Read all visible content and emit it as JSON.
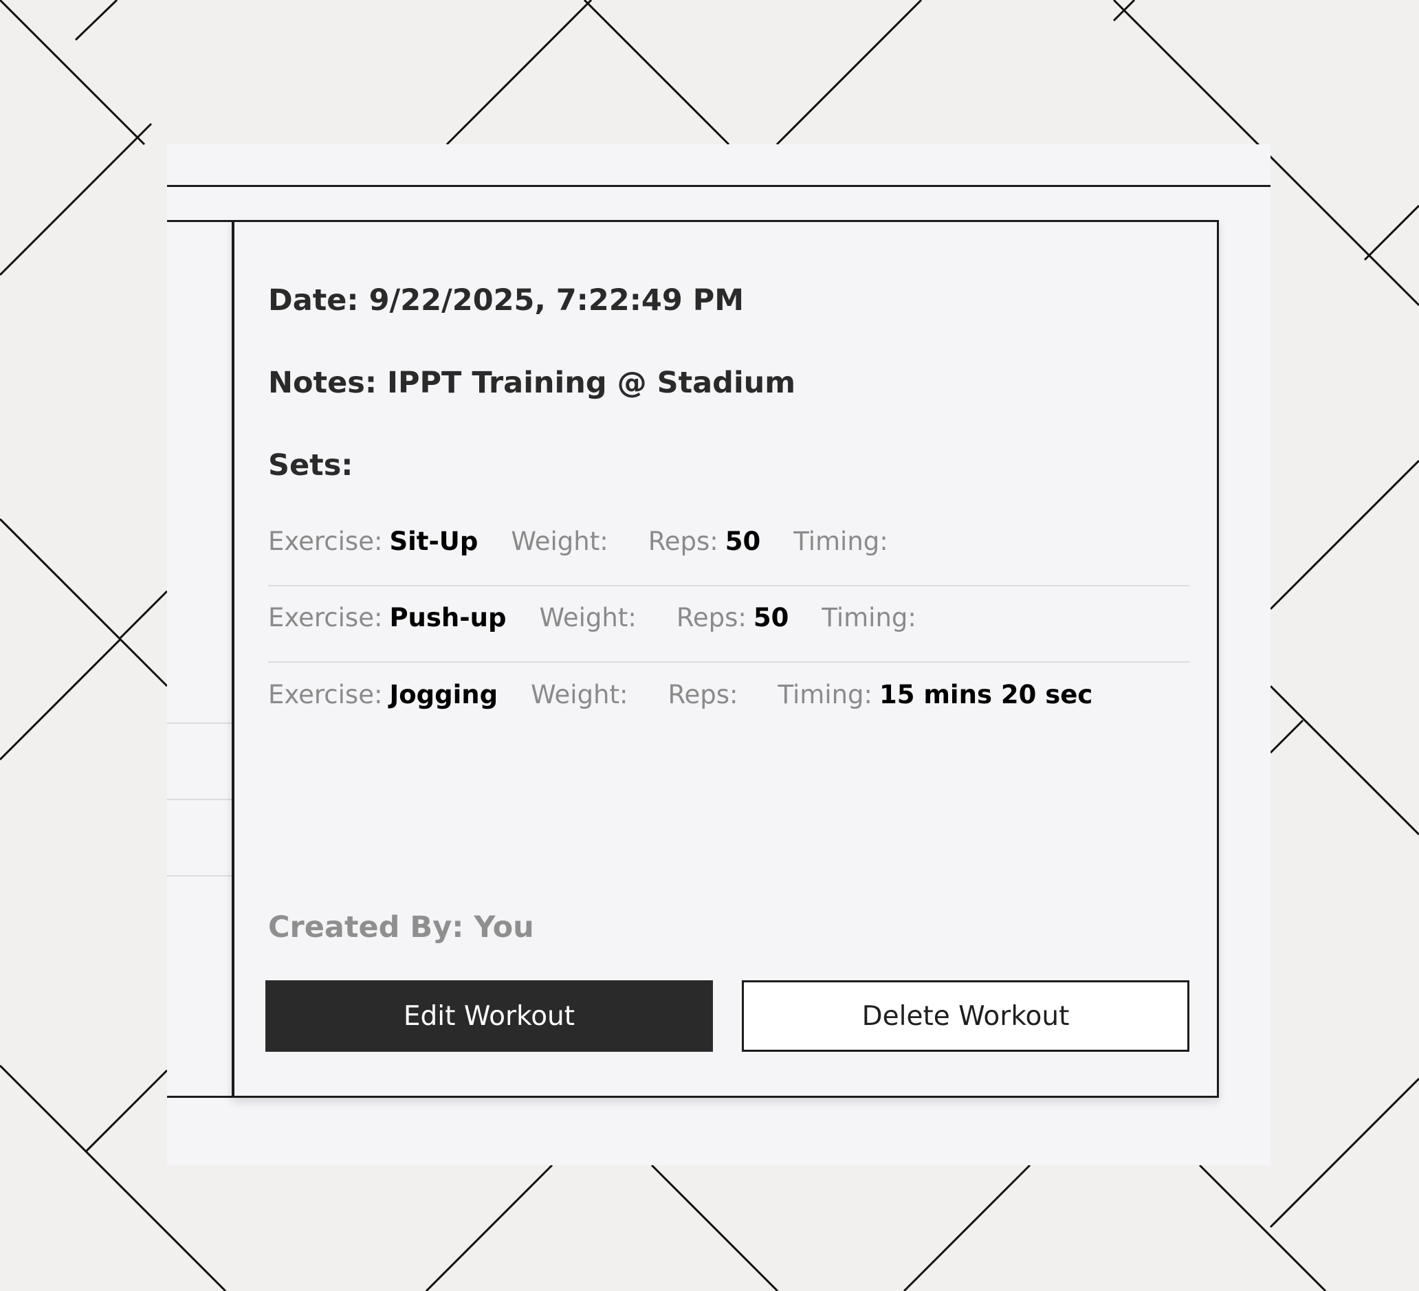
{
  "workout": {
    "date_label": "Date:",
    "date_value": "9/22/2025, 7:22:49 PM",
    "notes_label": "Notes:",
    "notes_value": "IPPT Training @ Stadium",
    "sets_heading": "Sets:",
    "sets": [
      {
        "exercise_label": "Exercise:",
        "exercise": "Sit-Up",
        "weight_label": "Weight:",
        "weight": "",
        "reps_label": "Reps:",
        "reps": "50",
        "timing_label": "Timing:",
        "timing": ""
      },
      {
        "exercise_label": "Exercise:",
        "exercise": "Push-up",
        "weight_label": "Weight:",
        "weight": "",
        "reps_label": "Reps:",
        "reps": "50",
        "timing_label": "Timing:",
        "timing": ""
      },
      {
        "exercise_label": "Exercise:",
        "exercise": "Jogging",
        "weight_label": "Weight:",
        "weight": "",
        "reps_label": "Reps:",
        "reps": "",
        "timing_label": "Timing:",
        "timing": "15 mins 20 sec"
      }
    ],
    "created_by_label": "Created By:",
    "created_by_value": "You"
  },
  "actions": {
    "edit_label": "Edit Workout",
    "delete_label": "Delete Workout"
  },
  "colors": {
    "page_background": "#f1f0ef",
    "panel_background": "#f5f5f8",
    "border": "#1c1c1c",
    "primary_button": "#2a2a2a",
    "muted_text": "#8a8a8a"
  }
}
